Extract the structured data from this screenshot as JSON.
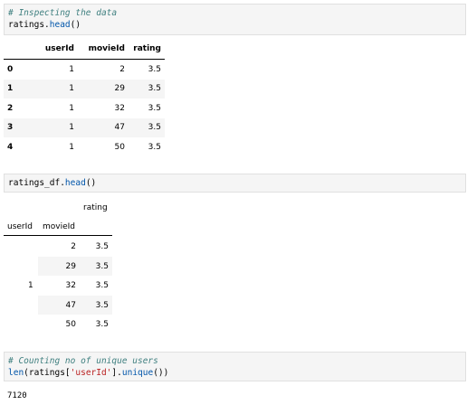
{
  "cell1": {
    "comment": "# Inspecting the data",
    "code_obj": "ratings.",
    "code_fn": "head",
    "code_tail": "()"
  },
  "table1": {
    "columns": [
      "userId",
      "movieId",
      "rating"
    ],
    "rows": [
      {
        "index": "0",
        "userId": "1",
        "movieId": "2",
        "rating": "3.5"
      },
      {
        "index": "1",
        "userId": "1",
        "movieId": "29",
        "rating": "3.5"
      },
      {
        "index": "2",
        "userId": "1",
        "movieId": "32",
        "rating": "3.5"
      },
      {
        "index": "3",
        "userId": "1",
        "movieId": "47",
        "rating": "3.5"
      },
      {
        "index": "4",
        "userId": "1",
        "movieId": "50",
        "rating": "3.5"
      }
    ]
  },
  "cell2": {
    "code_obj": "ratings_df.",
    "code_fn": "head",
    "code_tail": "()"
  },
  "table2": {
    "column": "rating",
    "index_names": [
      "userId",
      "movieId"
    ],
    "userId_value": "1",
    "rows": [
      {
        "movieId": "2",
        "rating": "3.5"
      },
      {
        "movieId": "29",
        "rating": "3.5"
      },
      {
        "movieId": "32",
        "rating": "3.5"
      },
      {
        "movieId": "47",
        "rating": "3.5"
      },
      {
        "movieId": "50",
        "rating": "3.5"
      }
    ]
  },
  "cell3": {
    "comment": "# Counting no of unique users",
    "code_fn1": "len",
    "code_mid1": "(ratings[",
    "code_str": "'userId'",
    "code_mid2": "].",
    "code_fn2": "unique",
    "code_tail": "())"
  },
  "output3": "7120"
}
